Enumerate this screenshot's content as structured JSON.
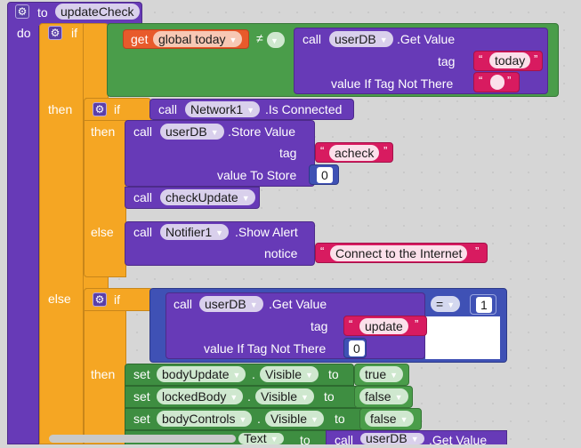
{
  "procedure": {
    "to_label": "to",
    "name": "updateCheck",
    "do_label": "do"
  },
  "outer_if": {
    "if_label": "if",
    "then_label": "then",
    "else_label": "else",
    "compare": {
      "get_label": "get",
      "var_name": "global today",
      "op": "≠",
      "call_label": "call",
      "component": "userDB",
      "method": ".Get Value",
      "tag_label": "tag",
      "tag_value": "today",
      "not_there_label": "value If Tag Not There",
      "not_there_value": ""
    }
  },
  "inner_if": {
    "if_label": "if",
    "then_label": "then",
    "else_label": "else",
    "cond": {
      "call_label": "call",
      "component": "Network1",
      "method": ".Is Connected"
    },
    "store": {
      "call_label": "call",
      "component": "userDB",
      "method": ".Store Value",
      "tag_label": "tag",
      "tag_value": "acheck",
      "value_label": "value To Store",
      "value": "0"
    },
    "check": {
      "call_label": "call",
      "procedure": "checkUpdate"
    },
    "alert": {
      "call_label": "call",
      "component": "Notifier1",
      "method": ".Show Alert",
      "notice_label": "notice",
      "notice_value": "Connect to the Internet"
    }
  },
  "second_if": {
    "if_label": "if",
    "then_label": "then",
    "getval": {
      "call_label": "call",
      "component": "userDB",
      "method": ".Get Value",
      "tag_label": "tag",
      "tag_value": "update",
      "not_there_label": "value If Tag Not There",
      "not_there_value": "0"
    },
    "op": "=",
    "compare_value": "1",
    "sets": [
      {
        "set_label": "set",
        "component": "bodyUpdate",
        "prop": "Visible",
        "to_label": "to",
        "value": "true"
      },
      {
        "set_label": "set",
        "component": "lockedBody",
        "prop": "Visible",
        "to_label": "to",
        "value": "false"
      },
      {
        "set_label": "set",
        "component": "bodyControls",
        "prop": "Visible",
        "to_label": "to",
        "value": "false"
      }
    ],
    "last_row": {
      "prop": "Text",
      "to_label": "to",
      "call_label": "call",
      "component": "userDB",
      "method": ".Get Value"
    }
  },
  "colors": {
    "procedure": "#673ab7",
    "control": "#f5a623",
    "logic": "#4a9d4a",
    "variable": "#e85a2b",
    "text": "#d81b60",
    "math": "#3f51b5"
  }
}
